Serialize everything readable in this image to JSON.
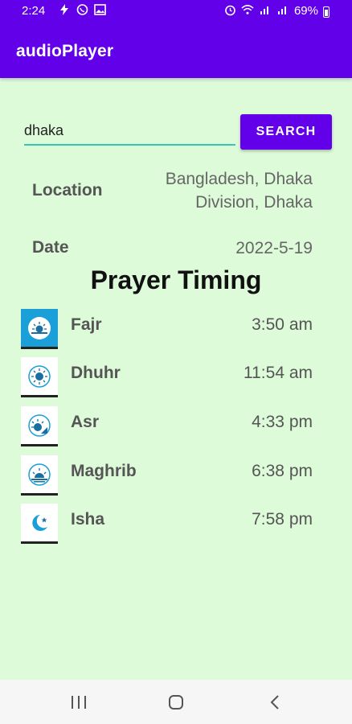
{
  "status_bar": {
    "time": "2:24",
    "battery": "69%",
    "left_icons": [
      "lightning-icon",
      "viber-icon",
      "gallery-icon"
    ],
    "right_icons": [
      "alarm-icon",
      "wifi-icon",
      "signal-icon",
      "signal-icon",
      "battery-icon"
    ]
  },
  "app_bar": {
    "title": "audioPlayer"
  },
  "search": {
    "value": "dhaka",
    "button_label": "SEARCH"
  },
  "location": {
    "label": "Location",
    "line1": "Bangladesh, Dhaka",
    "line2": "Division, Dhaka"
  },
  "date": {
    "label": "Date",
    "value": "2022-5-19"
  },
  "heading": "Prayer Timing",
  "prayers": [
    {
      "name": "Fajr",
      "time": "3:50 am",
      "icon": "sunrise-icon"
    },
    {
      "name": "Dhuhr",
      "time": "11:54 am",
      "icon": "sun-icon"
    },
    {
      "name": "Asr",
      "time": "4:33 pm",
      "icon": "afternoon-sun-icon"
    },
    {
      "name": "Maghrib",
      "time": "6:38 pm",
      "icon": "sunset-icon"
    },
    {
      "name": "Isha",
      "time": "7:58 pm",
      "icon": "crescent-moon-icon"
    }
  ],
  "colors": {
    "primary": "#6200ea",
    "background": "#ddfad9",
    "input_underline": "#35c7b5",
    "icon_accent": "#1a9fd8"
  }
}
